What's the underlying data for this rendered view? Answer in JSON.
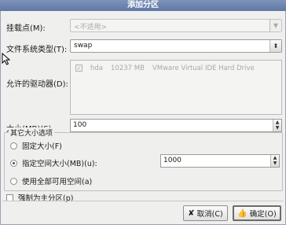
{
  "window": {
    "title": "添加分区"
  },
  "mount_point": {
    "label": "挂载点(M):",
    "value": "<不适用>"
  },
  "fs_type": {
    "label": "文件系统类型(T):",
    "value": "swap"
  },
  "drives": {
    "label": "允许的驱动器(D):",
    "rows": [
      {
        "name": "hda",
        "size": "10237 MB",
        "model": "VMware Virtual IDE Hard Drive",
        "checked": true
      }
    ]
  },
  "size": {
    "label": "大小(MB)(S):",
    "value": "100"
  },
  "options": {
    "title": "其它大小选项",
    "fixed": "固定大小(F)",
    "max": "指定空间大小(MB)(u):",
    "max_value": "1000",
    "fill": "使用全部可用空间(a)",
    "selected": "max"
  },
  "primary": {
    "label": "强制为主分区(p)",
    "checked": false
  },
  "buttons": {
    "cancel": "取消(C)",
    "ok": "确定(O)"
  },
  "icons": {
    "cancel": "x-icon",
    "ok": "thumbs-up-icon"
  }
}
